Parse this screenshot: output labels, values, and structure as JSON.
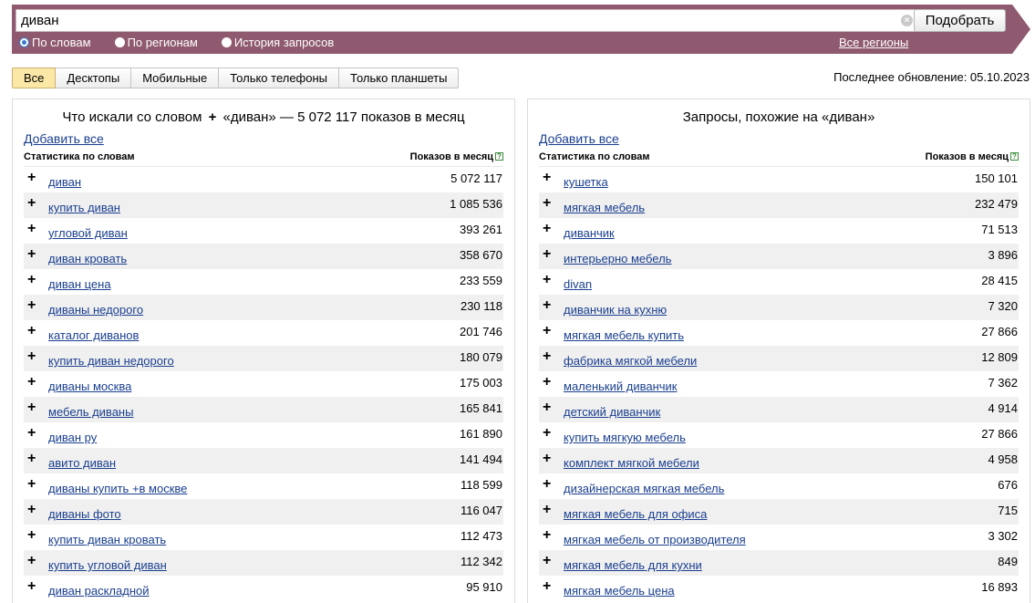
{
  "search": {
    "query": "диван",
    "submit_label": "Подобрать",
    "modes": [
      {
        "label": "По словам",
        "checked": true
      },
      {
        "label": "По регионам",
        "checked": false
      },
      {
        "label": "История запросов",
        "checked": false
      }
    ],
    "regions_link": "Все регионы"
  },
  "tabs": [
    "Все",
    "Десктопы",
    "Мобильные",
    "Только телефоны",
    "Только планшеты"
  ],
  "last_update": "Последнее обновление: 05.10.2023",
  "left": {
    "title_prefix": "Что искали со словом",
    "title_suffix": "«диван» — 5 072 117 показов в месяц",
    "add_all": "Добавить все",
    "col_words": "Статистика по словам",
    "col_count": "Показов в месяц",
    "rows": [
      {
        "word": "диван",
        "count": "5 072 117"
      },
      {
        "word": "купить диван",
        "count": "1 085 536"
      },
      {
        "word": "угловой диван",
        "count": "393 261"
      },
      {
        "word": "диван кровать",
        "count": "358 670"
      },
      {
        "word": "диван цена",
        "count": "233 559"
      },
      {
        "word": "диваны недорого",
        "count": "230 118"
      },
      {
        "word": "каталог диванов",
        "count": "201 746"
      },
      {
        "word": "купить диван недорого",
        "count": "180 079"
      },
      {
        "word": "диваны москва",
        "count": "175 003"
      },
      {
        "word": "мебель диваны",
        "count": "165 841"
      },
      {
        "word": "диван ру",
        "count": "161 890"
      },
      {
        "word": "авито диван",
        "count": "141 494"
      },
      {
        "word": "диваны купить +в москве",
        "count": "118 599"
      },
      {
        "word": "диваны фото",
        "count": "116 047"
      },
      {
        "word": "купить диван кровать",
        "count": "112 473"
      },
      {
        "word": "купить угловой диван",
        "count": "112 342"
      },
      {
        "word": "диван раскладной",
        "count": "95 910"
      }
    ]
  },
  "right": {
    "title": "Запросы, похожие на «диван»",
    "add_all": "Добавить все",
    "col_words": "Статистика по словам",
    "col_count": "Показов в месяц",
    "rows": [
      {
        "word": "кушетка",
        "count": "150 101"
      },
      {
        "word": "мягкая мебель",
        "count": "232 479"
      },
      {
        "word": "диванчик",
        "count": "71 513"
      },
      {
        "word": "интерьерно мебель",
        "count": "3 896"
      },
      {
        "word": "divan",
        "count": "28 415"
      },
      {
        "word": "диванчик на кухню",
        "count": "7 320"
      },
      {
        "word": "мягкая мебель купить",
        "count": "27 866"
      },
      {
        "word": "фабрика мягкой мебели",
        "count": "12 809"
      },
      {
        "word": "маленький диванчик",
        "count": "7 362"
      },
      {
        "word": "детский диванчик",
        "count": "4 914"
      },
      {
        "word": "купить мягкую мебель",
        "count": "27 866"
      },
      {
        "word": "комплект мягкой мебели",
        "count": "4 958"
      },
      {
        "word": "дизайнерская мягкая мебель",
        "count": "676"
      },
      {
        "word": "мягкая мебель для офиса",
        "count": "715"
      },
      {
        "word": "мягкая мебель от производителя",
        "count": "3 302"
      },
      {
        "word": "мягкая мебель для кухни",
        "count": "849"
      },
      {
        "word": "мягкая мебель цена",
        "count": "16 893"
      }
    ]
  }
}
